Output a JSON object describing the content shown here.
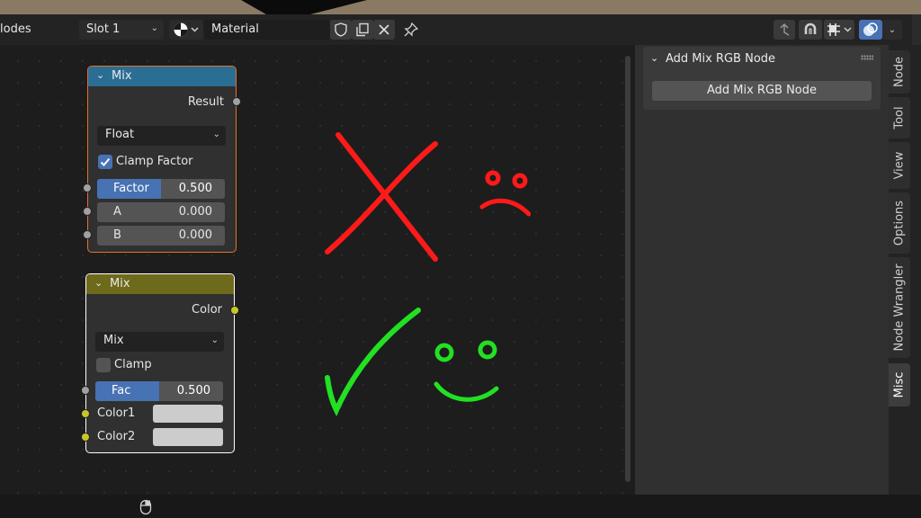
{
  "header": {
    "editor_label": "lodes",
    "slot": {
      "label": "Slot 1"
    },
    "material": {
      "label": "Material"
    },
    "icons": [
      "material-sphere-icon",
      "shield-icon",
      "duplicate-icon",
      "close-icon",
      "pin-icon",
      "parent-arrow-icon",
      "snap-magnet-icon",
      "snap-grid-icon",
      "overlay-icon"
    ]
  },
  "nodes": [
    {
      "title": "Mix",
      "header_color": "#2a6e94",
      "output_label": "Result",
      "dropdown": "Float",
      "checkbox": {
        "label": "Clamp Factor",
        "checked": true
      },
      "inputs": [
        {
          "label": "Factor",
          "value": "0.500",
          "fraction": 0.5
        },
        {
          "label": "A",
          "value": "0.000"
        },
        {
          "label": "B",
          "value": "0.000"
        }
      ],
      "selected": true
    },
    {
      "title": "Mix",
      "header_color": "#6d6a1c",
      "output_label": "Color",
      "dropdown": "Mix",
      "checkbox": {
        "label": "Clamp",
        "checked": false
      },
      "fac": {
        "label": "Fac",
        "value": "0.500",
        "fraction": 0.5
      },
      "colors": [
        {
          "label": "Color1",
          "swatch": "#cccccc"
        },
        {
          "label": "Color2",
          "swatch": "#cccccc"
        }
      ],
      "selected": false
    }
  ],
  "annotations": {
    "wrong_mark_color": "#ff1a1a",
    "right_mark_color": "#22e022"
  },
  "sidebar": {
    "panel_title": "Add Mix RGB Node",
    "panel_button": "Add Mix RGB Node",
    "tabs": [
      {
        "label": "Node",
        "active": false
      },
      {
        "label": "Tool",
        "active": false
      },
      {
        "label": "View",
        "active": false
      },
      {
        "label": "Options",
        "active": false
      },
      {
        "label": "Node Wrangler",
        "active": false
      },
      {
        "label": "Misc",
        "active": true
      }
    ]
  },
  "colors": {
    "socket_gray": "#a1a1a1",
    "socket_yellow": "#c7c729",
    "accent_blue": "#4772b3"
  }
}
